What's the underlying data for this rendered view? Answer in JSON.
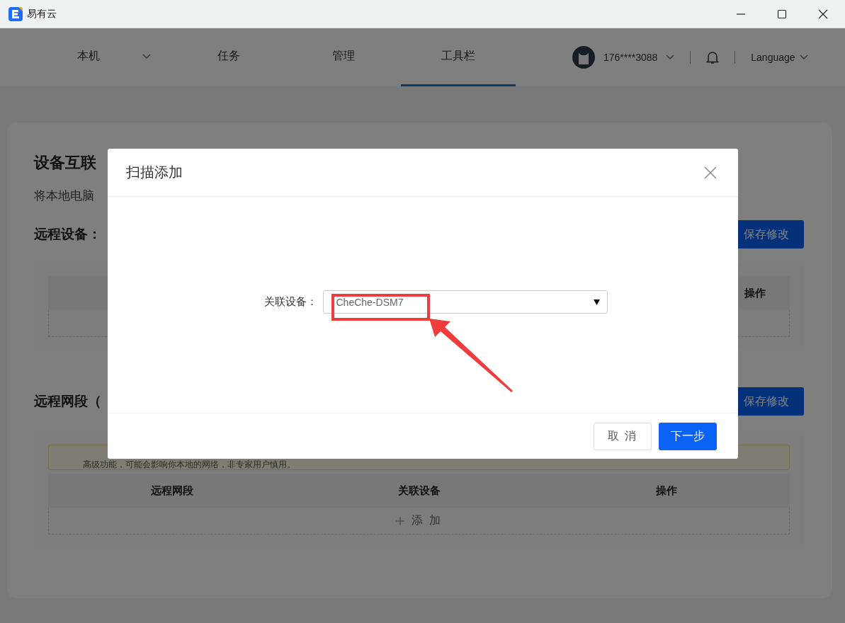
{
  "window": {
    "title": "易有云"
  },
  "nav": {
    "tabs": [
      {
        "label": "本机",
        "selected": false,
        "dropdown": true
      },
      {
        "label": "任务",
        "selected": false,
        "dropdown": false
      },
      {
        "label": "管理",
        "selected": false,
        "dropdown": false
      },
      {
        "label": "工具栏",
        "selected": true,
        "dropdown": false
      }
    ],
    "account": "176****3088",
    "language": "Language"
  },
  "page": {
    "title": "设备互联",
    "description": "将本地电脑",
    "remote_devices": {
      "title": "远程设备：",
      "save_button": "保存修改",
      "columns": [
        "操作"
      ]
    },
    "remote_segments": {
      "title": "远程网段（",
      "save_button": "保存修改",
      "notice": "高级功能，可能会影响你本地的网络，非专家用户慎用。",
      "columns": [
        "远程网段",
        "关联设备",
        "操作"
      ],
      "add_label": "添 加"
    }
  },
  "dialog": {
    "title": "扫描添加",
    "field_label": "关联设备：",
    "value": "CheChe-DSM7",
    "buttons": [
      {
        "label": "取 消",
        "kind": "default"
      },
      {
        "label": "下一步",
        "kind": "primary"
      }
    ]
  }
}
